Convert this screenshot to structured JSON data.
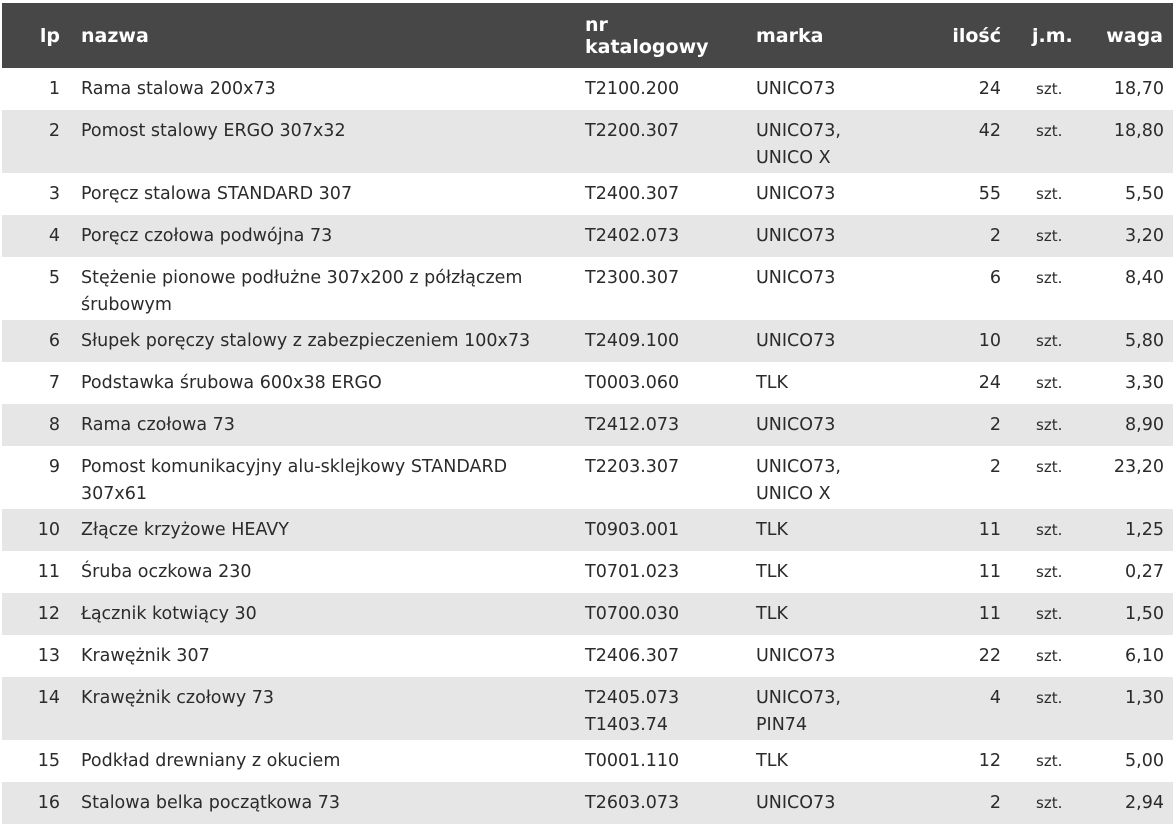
{
  "table": {
    "headers": {
      "lp": "lp",
      "name": "nazwa",
      "catalog": "nr katalogowy",
      "brand": "marka",
      "qty": "ilość",
      "unit": "j.m.",
      "weight": "waga"
    },
    "rows": [
      {
        "lp": "1",
        "name": "Rama stalowa 200x73",
        "catalog": [
          "T2100.200"
        ],
        "brand": [
          "UNICO73"
        ],
        "qty": "24",
        "unit": "szt.",
        "weight": "18,70"
      },
      {
        "lp": "2",
        "name": "Pomost stalowy ERGO 307x32",
        "catalog": [
          "T2200.307"
        ],
        "brand": [
          "UNICO73,",
          "UNICO X"
        ],
        "qty": "42",
        "unit": "szt.",
        "weight": "18,80"
      },
      {
        "lp": "3",
        "name": "Poręcz stalowa STANDARD 307",
        "catalog": [
          "T2400.307"
        ],
        "brand": [
          "UNICO73"
        ],
        "qty": "55",
        "unit": "szt.",
        "weight": "5,50"
      },
      {
        "lp": "4",
        "name": "Poręcz czołowa podwójna 73",
        "catalog": [
          "T2402.073"
        ],
        "brand": [
          "UNICO73"
        ],
        "qty": "2",
        "unit": "szt.",
        "weight": "3,20"
      },
      {
        "lp": "5",
        "name": "Stężenie pionowe podłużne 307x200 z półzłączem śrubowym",
        "catalog": [
          "T2300.307"
        ],
        "brand": [
          "UNICO73"
        ],
        "qty": "6",
        "unit": "szt.",
        "weight": "8,40"
      },
      {
        "lp": "6",
        "name": "Słupek poręczy stalowy z zabezpieczeniem 100x73",
        "catalog": [
          "T2409.100"
        ],
        "brand": [
          "UNICO73"
        ],
        "qty": "10",
        "unit": "szt.",
        "weight": "5,80"
      },
      {
        "lp": "7",
        "name": "Podstawka śrubowa 600x38 ERGO",
        "catalog": [
          "T0003.060"
        ],
        "brand": [
          "TLK"
        ],
        "qty": "24",
        "unit": "szt.",
        "weight": "3,30"
      },
      {
        "lp": "8",
        "name": "Rama czołowa 73",
        "catalog": [
          "T2412.073"
        ],
        "brand": [
          "UNICO73"
        ],
        "qty": "2",
        "unit": "szt.",
        "weight": "8,90"
      },
      {
        "lp": "9",
        "name": "Pomost komunikacyjny alu-sklejkowy STANDARD 307x61",
        "catalog": [
          "T2203.307"
        ],
        "brand": [
          "UNICO73,",
          "UNICO X"
        ],
        "qty": "2",
        "unit": "szt.",
        "weight": "23,20"
      },
      {
        "lp": "10",
        "name": "Złącze krzyżowe HEAVY",
        "catalog": [
          "T0903.001"
        ],
        "brand": [
          "TLK"
        ],
        "qty": "11",
        "unit": "szt.",
        "weight": "1,25"
      },
      {
        "lp": "11",
        "name": "Śruba oczkowa 230",
        "catalog": [
          "T0701.023"
        ],
        "brand": [
          "TLK"
        ],
        "qty": "11",
        "unit": "szt.",
        "weight": "0,27"
      },
      {
        "lp": "12",
        "name": "Łącznik kotwiący 30",
        "catalog": [
          "T0700.030"
        ],
        "brand": [
          "TLK"
        ],
        "qty": "11",
        "unit": "szt.",
        "weight": "1,50"
      },
      {
        "lp": "13",
        "name": "Krawężnik 307",
        "catalog": [
          "T2406.307"
        ],
        "brand": [
          "UNICO73"
        ],
        "qty": "22",
        "unit": "szt.",
        "weight": "6,10"
      },
      {
        "lp": "14",
        "name": "Krawężnik czołowy 73",
        "catalog": [
          "T2405.073",
          "T1403.74"
        ],
        "brand": [
          "UNICO73,",
          "PIN74"
        ],
        "qty": "4",
        "unit": "szt.",
        "weight": "1,30"
      },
      {
        "lp": "15",
        "name": "Podkład drewniany z okuciem",
        "catalog": [
          "T0001.110"
        ],
        "brand": [
          "TLK"
        ],
        "qty": "12",
        "unit": "szt.",
        "weight": "5,00"
      },
      {
        "lp": "16",
        "name": "Stalowa belka początkowa 73",
        "catalog": [
          "T2603.073"
        ],
        "brand": [
          "UNICO73"
        ],
        "qty": "2",
        "unit": "szt.",
        "weight": "2,94"
      }
    ]
  },
  "colors": {
    "header_bg": "#474747",
    "header_text": "#ffffff",
    "stripe_bg": "#e6e6e6",
    "text": "#2b2b2b"
  }
}
